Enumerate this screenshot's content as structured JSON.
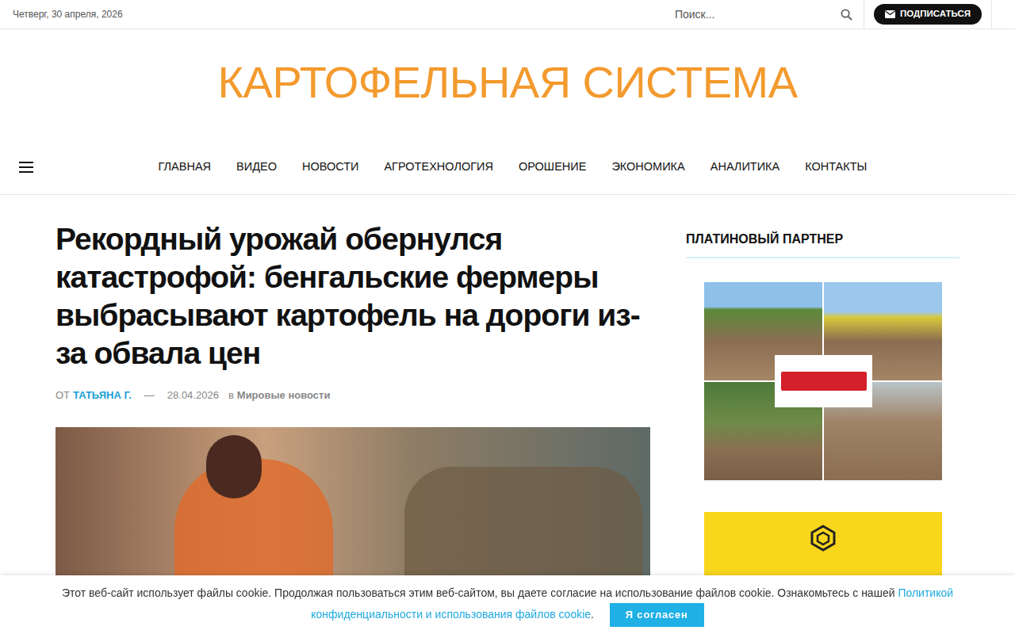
{
  "top_bar": {
    "date": "Четверг, 30 апреля, 2026",
    "search": {
      "placeholder": "Поиск..."
    },
    "subscribe": "ПОДПИСАТЬСЯ"
  },
  "logo": "КАРТОФЕЛЬНАЯ СИСТЕМА",
  "nav": [
    {
      "label": "ГЛАВНАЯ"
    },
    {
      "label": "ВИДЕО"
    },
    {
      "label": "НОВОСТИ"
    },
    {
      "label": "АГРОТЕХНОЛОГИЯ"
    },
    {
      "label": "ОРОШЕНИЕ"
    },
    {
      "label": "ЭКОНОМИКА"
    },
    {
      "label": "АНАЛИТИКА"
    },
    {
      "label": "КОНТАКТЫ"
    }
  ],
  "article": {
    "title": "Рекордный урожай обернулся катастрофой: бенгальские фермеры выбрасывают картофель на дороги из-за обвала цен",
    "meta": {
      "by": "ОТ",
      "author": "ТАТЬЯНА Г.",
      "dash": "—",
      "date": "28.04.2026",
      "in": "в",
      "category": "Мировые новости"
    }
  },
  "sidebar": {
    "heading": "ПЛАТИНОВЫЙ ПАРТНЕР"
  },
  "cookie": {
    "text": "Этот веб-сайт использует файлы cookie. Продолжая пользоваться этим веб-сайтом, вы даете согласие на использование файлов cookie. Ознакомьтесь с нашей ",
    "link": "Политикой конфиденциальности и использования файлов cookie",
    "after": ".",
    "button": "Я согласен"
  }
}
